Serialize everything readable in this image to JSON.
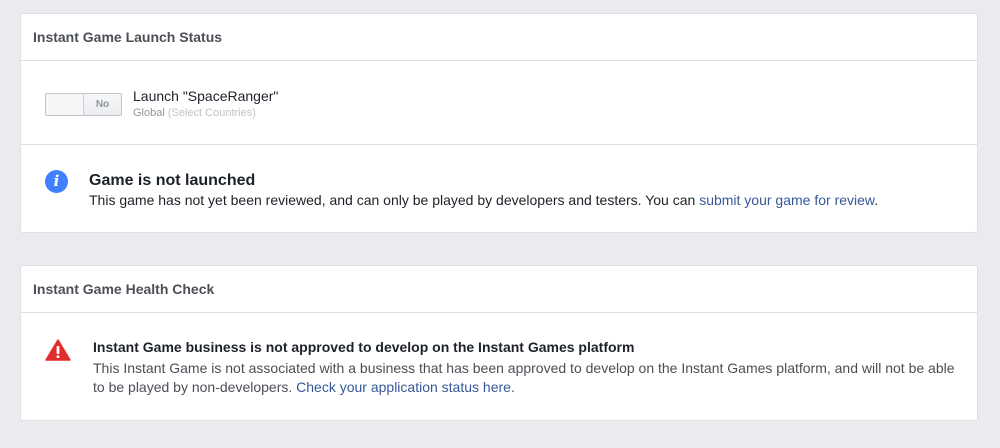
{
  "launch_panel": {
    "header": "Instant Game Launch Status",
    "toggle_label": "No",
    "game_title": "Launch \"SpaceRanger\"",
    "region": "Global",
    "select_countries": "(Select Countries)",
    "notice": {
      "icon": "info-icon",
      "title": "Game is not launched",
      "body": "This game has not yet been reviewed, and can only be played by developers and testers. You can ",
      "link": "submit your game for review",
      "body_end": "."
    }
  },
  "health_panel": {
    "header": "Instant Game Health Check",
    "warning": {
      "icon": "warning-icon",
      "title": "Instant Game business is not approved to develop on the Instant Games platform",
      "body": "This Instant Game is not associated with a business that has been approved to develop on the Instant Games platform, and will not be able to be played by non-developers. ",
      "link": "Check your application status here",
      "body_end": "."
    }
  },
  "colors": {
    "page_bg": "#e9ebee",
    "link": "#365899",
    "info": "#4080ff",
    "warning": "#e02c2c"
  }
}
